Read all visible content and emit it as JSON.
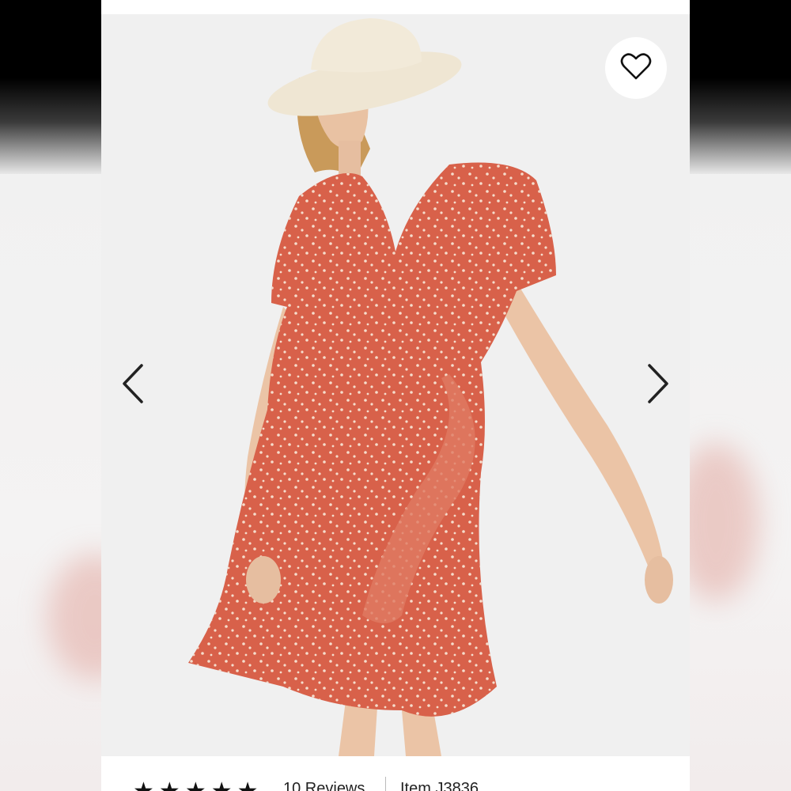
{
  "product": {
    "image_alt": "Woman wearing red printed ruffle wrap mini dress and a straw bucket hat",
    "dress_color": "#d8614a",
    "background_color": "#f0f0f0"
  },
  "icons": {
    "wishlist": "heart-icon",
    "previous": "chevron-left-icon",
    "next": "chevron-right-icon",
    "rating": "star-icon"
  },
  "rating": {
    "stars": 5,
    "star_glyphs": [
      "★",
      "★",
      "★",
      "★",
      "★"
    ],
    "reviews_label": "10 Reviews"
  },
  "item": {
    "label": "Item J3836"
  }
}
